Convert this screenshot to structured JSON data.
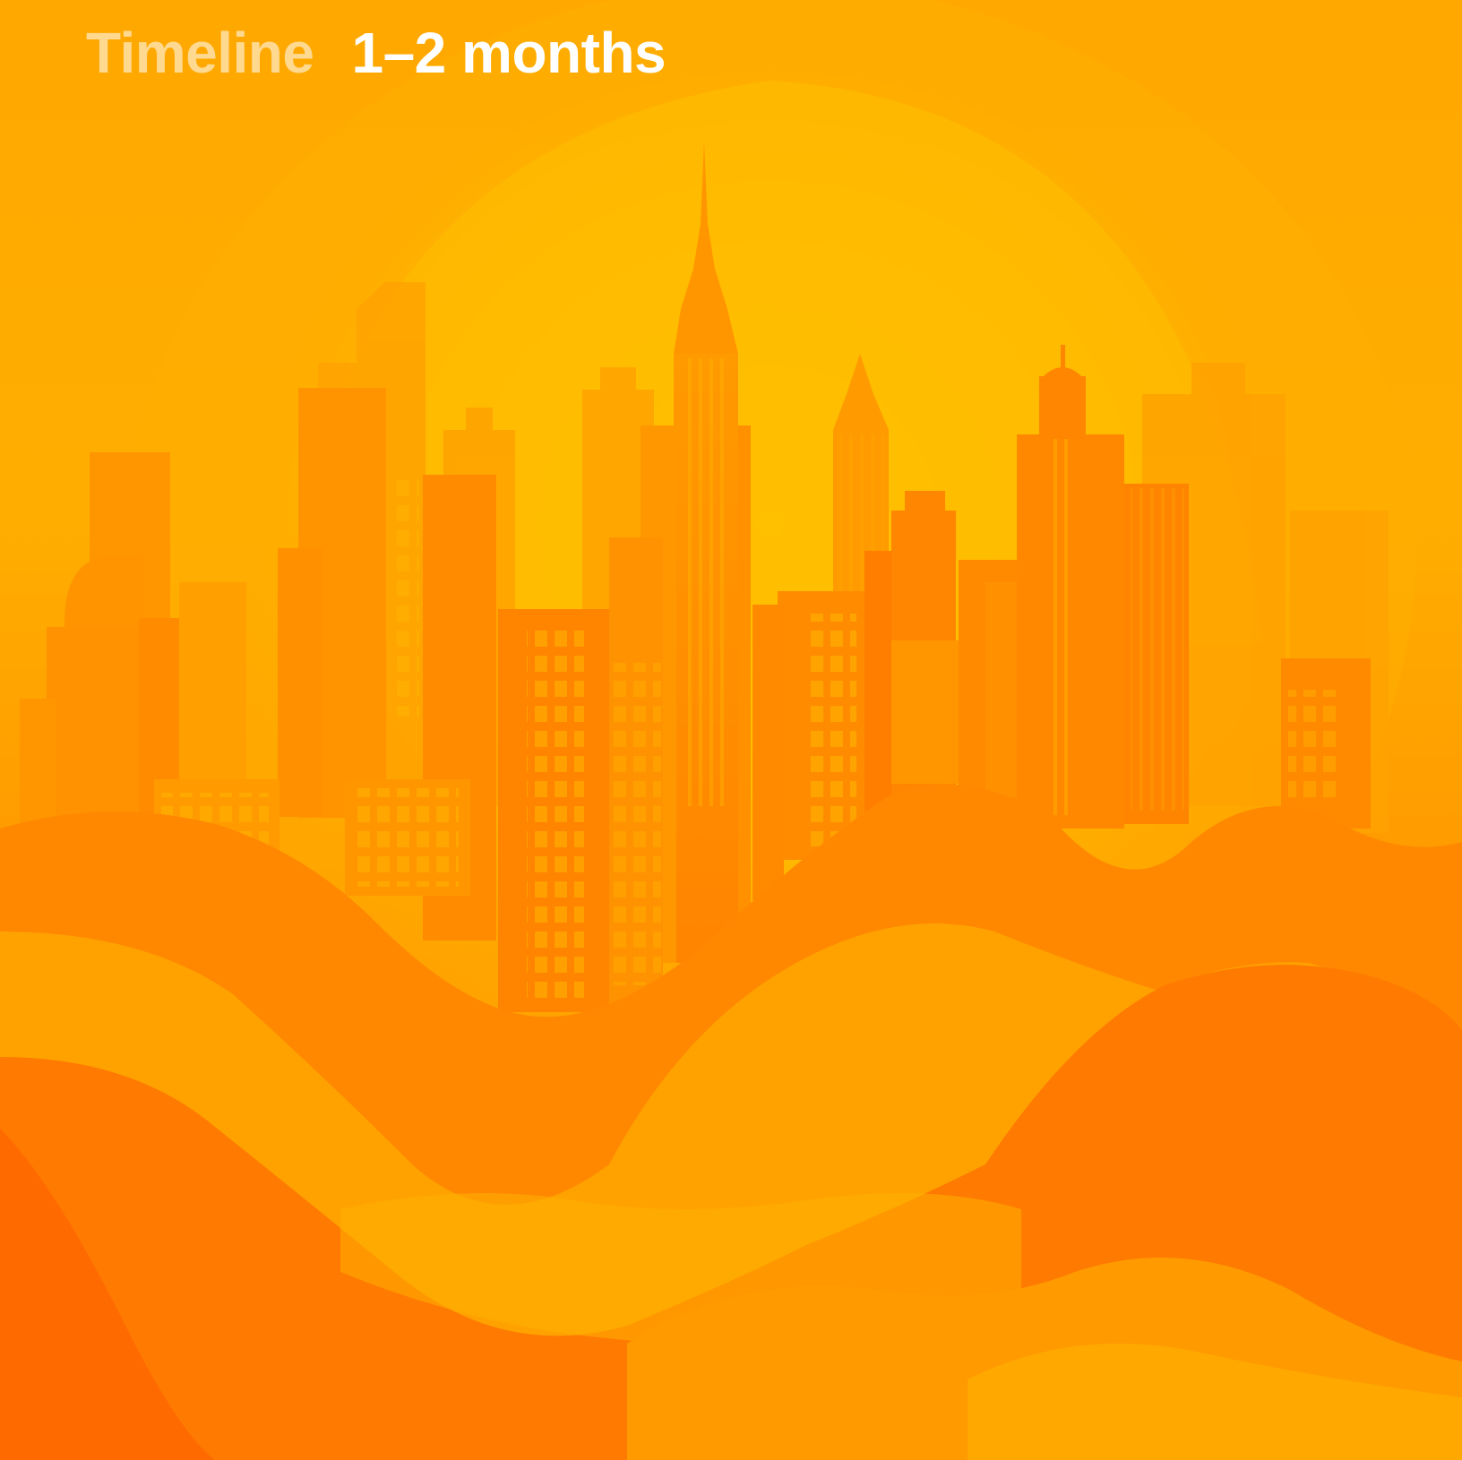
{
  "header": {
    "label": "Timeline",
    "value": "1–2 months"
  },
  "illustration": {
    "name": "orange-city-skyline-with-waves",
    "colors": {
      "background": "#ffa800",
      "sun": "#ffc000",
      "building_light": "#ffa000",
      "building_mid": "#ff8c00",
      "building_dark": "#ff7a00",
      "wave_light": "#ffb000",
      "wave_dark": "#ff6a00"
    }
  }
}
